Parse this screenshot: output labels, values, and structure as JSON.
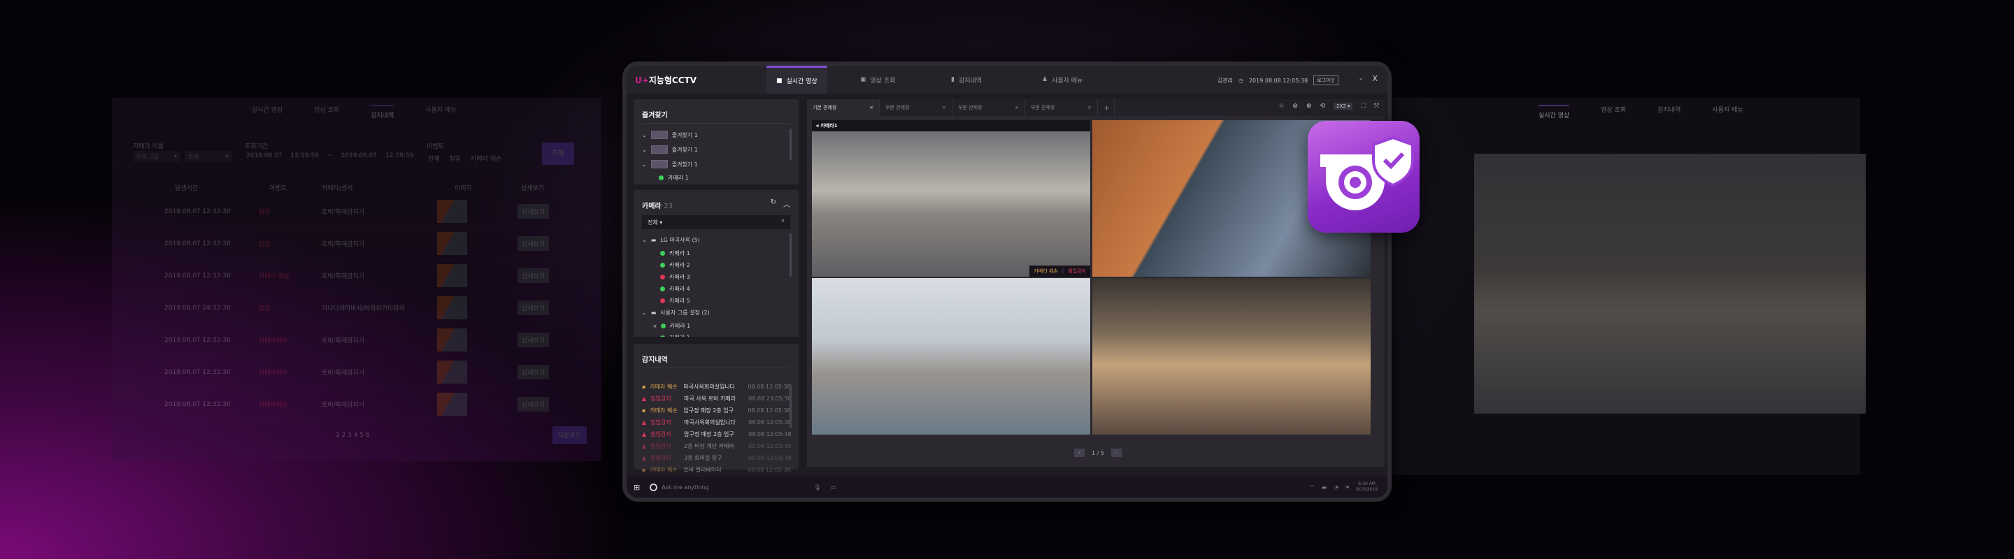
{
  "colors": {
    "accent": "#7d4fd0",
    "brand": "#d0208a",
    "online": "#3ecf5a",
    "offline": "#e0375a",
    "damage": "#d9a24a",
    "intrusion": "#e0375a"
  },
  "app": {
    "logo_prefix": "U+",
    "title": "지능형CCTV",
    "user": "김관리",
    "datetime": "2019.08.08 12:05:38",
    "logout": "로그아웃",
    "minimize": "-",
    "close": "X"
  },
  "nav": [
    {
      "label": "실시간 영상",
      "icon": "video-camera-icon",
      "active": true
    },
    {
      "label": "영상 조회",
      "icon": "playback-icon"
    },
    {
      "label": "감지내역",
      "icon": "bar-chart-icon"
    },
    {
      "label": "사용자 메뉴",
      "icon": "user-icon"
    }
  ],
  "favorites": {
    "title": "즐겨찾기",
    "items": [
      {
        "label": "즐겨찾기 1"
      },
      {
        "label": "즐겨찾기 1"
      },
      {
        "label": "즐겨찾기 1"
      }
    ],
    "camera": "카메라 1"
  },
  "cameras": {
    "title": "카메라",
    "count": "23",
    "filter": "전체",
    "groups": [
      {
        "label": "LG 마곡사옥 (5)",
        "items": [
          {
            "label": "카메라 1",
            "status": "online"
          },
          {
            "label": "카메라 2",
            "status": "online"
          },
          {
            "label": "카메라 3",
            "status": "offline"
          },
          {
            "label": "카메라 4",
            "status": "online"
          },
          {
            "label": "카메라 5",
            "status": "offline"
          }
        ]
      },
      {
        "label": "사용자 그룹 설정 (2)",
        "items": [
          {
            "label": "카메라 1",
            "status": "online",
            "shared": true
          },
          {
            "label": "카메라 1",
            "status": "online"
          }
        ]
      }
    ]
  },
  "detections": {
    "title": "감지내역",
    "items": [
      {
        "type": "카메라 훼손",
        "kind": "damage",
        "place": "마곡사옥회의실입니다",
        "time": "08.08  12:05:38"
      },
      {
        "type": "침입감지",
        "kind": "intrusion",
        "place": "마곡 사옥 로비 카메라",
        "time": "08.08  23:05:38"
      },
      {
        "type": "카메라 훼손",
        "kind": "damage",
        "place": "압구정 매장 2층 입구",
        "time": "08.08  12:05:38"
      },
      {
        "type": "침입감지",
        "kind": "intrusion",
        "place": "마곡사옥회의실입니다",
        "time": "08.08  12:05:38"
      },
      {
        "type": "침입감지",
        "kind": "intrusion",
        "place": "압구정 매장 2층 입구",
        "time": "08.08  12:05:38"
      },
      {
        "type": "침입감지",
        "kind": "intrusion",
        "place": "2층 비상 계단 카메라",
        "time": "08.08  12:05:38"
      },
      {
        "type": "침입감지",
        "kind": "intrusion",
        "place": "3층 회의실 입구",
        "time": "08.08  12:05:38"
      },
      {
        "type": "카메라 훼손",
        "kind": "damage",
        "place": "로비 엘리베이터",
        "time": "08.08  12:05:38"
      }
    ]
  },
  "view_tabs": [
    {
      "label": "기본 관제창",
      "active": true
    },
    {
      "label": "부분 관제창"
    },
    {
      "label": "부분 관제창"
    },
    {
      "label": "부분 관제창"
    }
  ],
  "toolbar": {
    "layout": "2X2"
  },
  "video": {
    "camera_title": "카메라1",
    "alert_damage": "카메라 훼손",
    "alert_intrusion": "침입감지",
    "page": "1 / 5"
  },
  "taskbar": {
    "search": "Ask me anything",
    "time": "6:30 AM",
    "date": "8/10/2019"
  },
  "ghost_left": {
    "tabs": [
      "실시간 영상",
      "영상 조회",
      "감지내역",
      "사용자 메뉴"
    ],
    "filters": {
      "camera_name": "카메라 이름",
      "group": "전체 그룹",
      "lobby": "로비",
      "period": "조회기간",
      "date_from": "2019.08.07",
      "time_from": "12:59:59",
      "date_to": "2019.08.07",
      "time_to": "12:59:59",
      "event": "이벤트",
      "all": "전체",
      "intrusion": "침입",
      "damage": "카메라 훼손",
      "search": "조회"
    },
    "columns": [
      "발생시간",
      "이벤트",
      "카메라/센서",
      "이미지",
      "상세보기"
    ],
    "rows": [
      {
        "time": "2019.08.07 12:32:30",
        "event": "침입",
        "camera": "로비/화재감지기"
      },
      {
        "time": "2019.08.07 12:32:30",
        "event": "침입",
        "camera": "로비/화재감지기"
      },
      {
        "time": "2019.08.07 12:32:30",
        "event": "카메라 훼손",
        "camera": "로비/화재감지기"
      },
      {
        "time": "2019.08.07 24:32:30",
        "event": "침입",
        "camera": "가나다라마바사/아자차카타파하"
      },
      {
        "time": "2019.08.07 12:32:30",
        "event": "카메라훼손",
        "camera": "로비/화재감지기"
      },
      {
        "time": "2019.08.07 12:32:30",
        "event": "카메라훼손",
        "camera": "로비/화재감지기"
      },
      {
        "time": "2019.08.07 12:32:30",
        "event": "카메라훼손",
        "camera": "로비/화재감지기"
      }
    ],
    "detail": "상세보기",
    "pages": "1 2 3 4 5 6",
    "download": "다운로드"
  },
  "ghost_right": {
    "tabs": [
      "실시간 영상",
      "영상 조회",
      "감지내역",
      "사용자 메뉴"
    ]
  }
}
